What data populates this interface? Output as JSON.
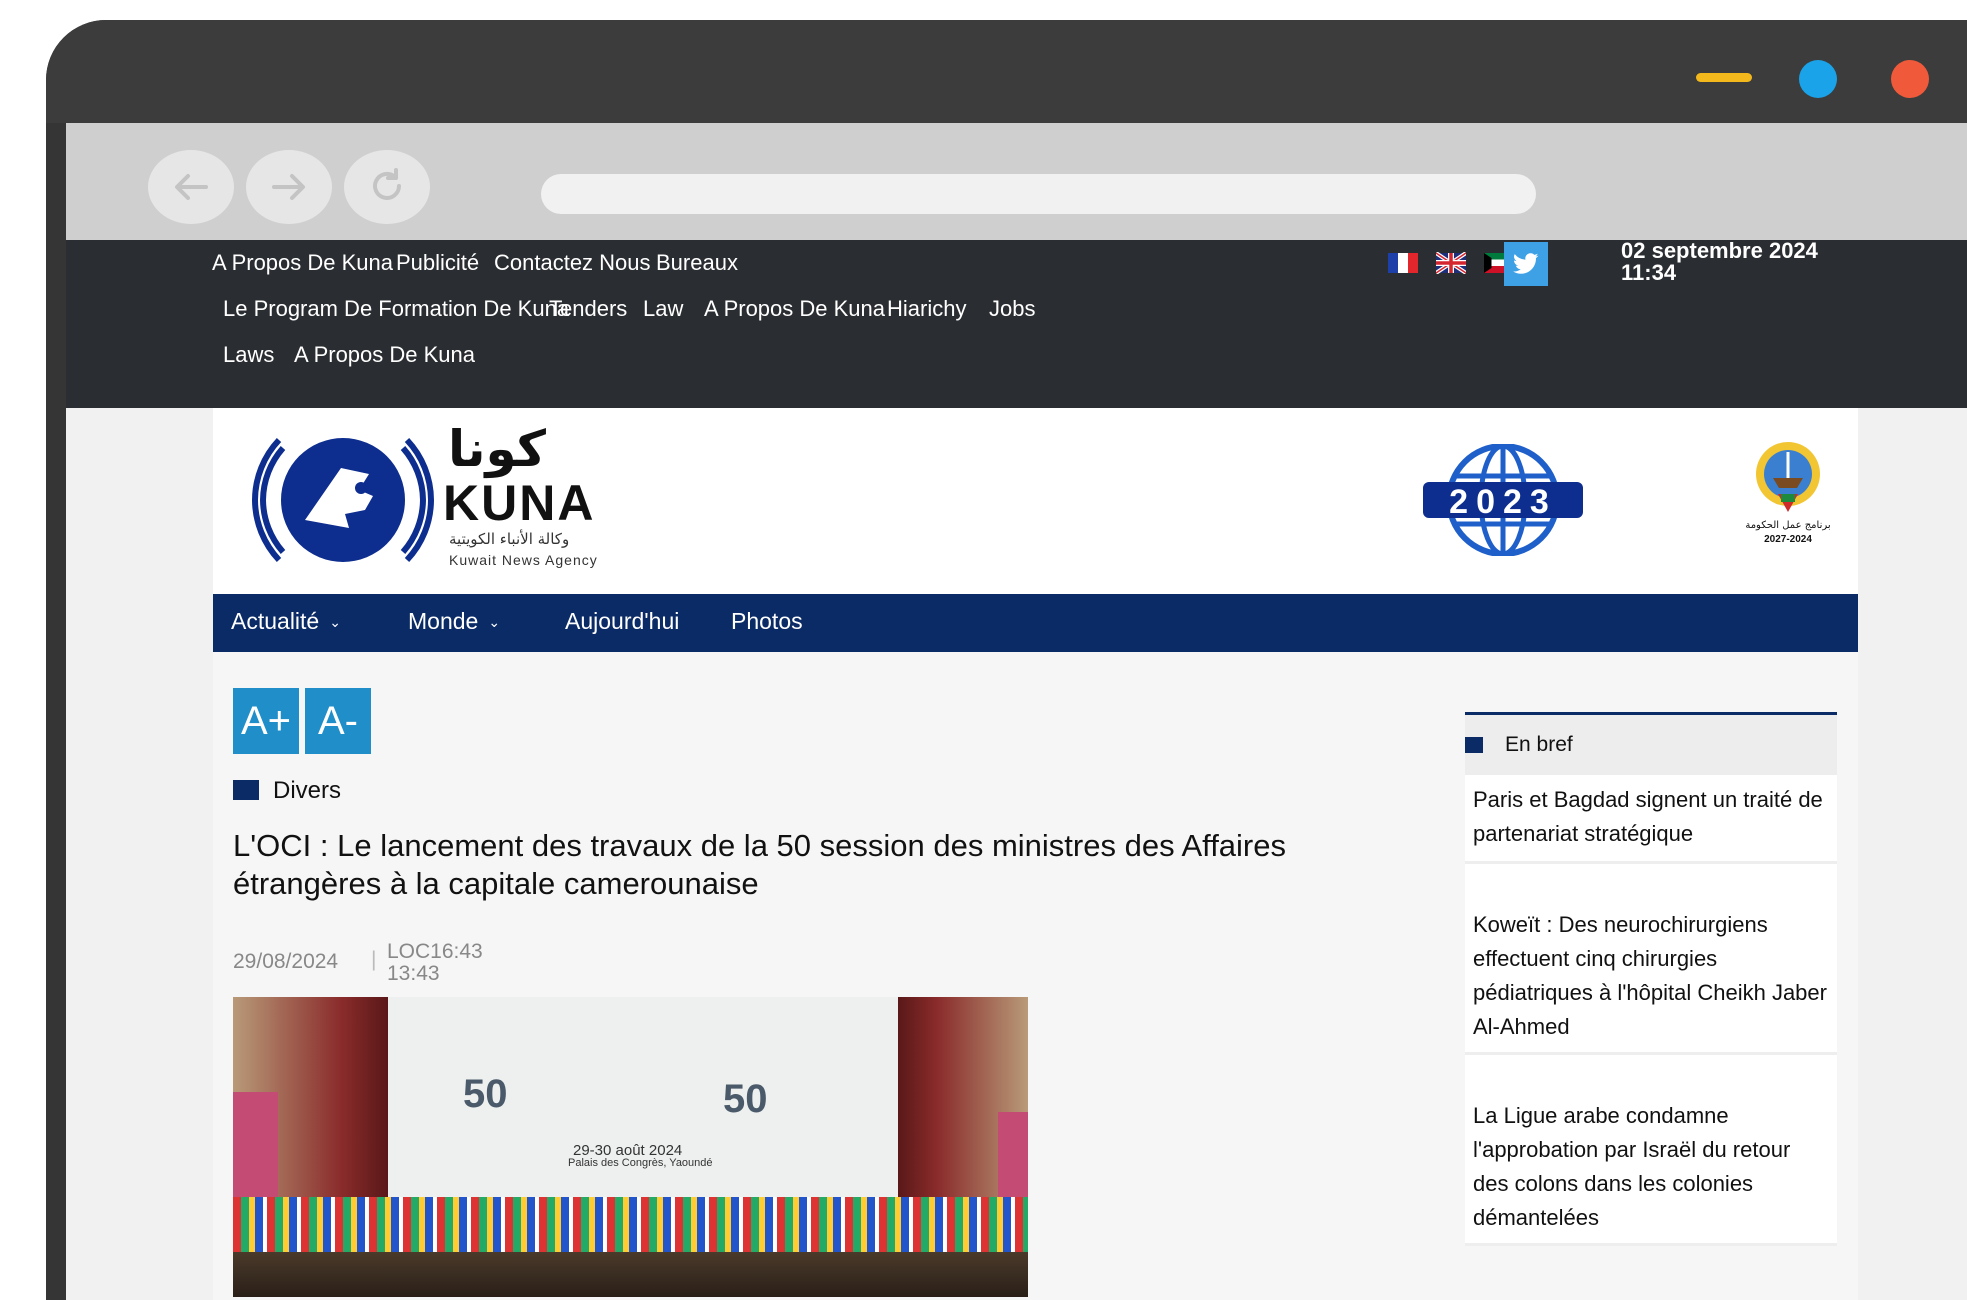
{
  "window": {
    "controls": {
      "minimize_color": "#f2b81c",
      "maximize_color": "#1aa3e8",
      "close_color": "#f05a3a"
    },
    "nav_icons": [
      "back-arrow-icon",
      "forward-arrow-icon",
      "reload-icon"
    ]
  },
  "topbar": {
    "row1": [
      "A Propos De Kuna",
      "Publicité",
      "Contactez Nous",
      "Bureaux"
    ],
    "row2": [
      "Le Program De Formation De Kuna",
      "Tenders",
      "Law",
      "A Propos De Kuna",
      "Hiarichy",
      "Jobs"
    ],
    "row3": [
      "Laws",
      "A Propos De Kuna"
    ],
    "flags": [
      "france-flag-icon",
      "uk-flag-icon",
      "kuwait-flag-icon"
    ],
    "twitter_icon": "twitter-icon",
    "date": "02 septembre 2024",
    "time": "11:34"
  },
  "header": {
    "logo_arabic": "كونا",
    "logo_latin": "KUNA",
    "logo_sub_arabic": "وكالة الأنباء الكويتية",
    "logo_sub_latin": "Kuwait News Agency",
    "badge_year": "2023",
    "emblem_text_arabic": "برنامج عمل الحكومة",
    "emblem_years": "2027-2024"
  },
  "mainnav": {
    "items": [
      {
        "label": "Actualité",
        "has_dropdown": true
      },
      {
        "label": "Monde",
        "has_dropdown": true
      },
      {
        "label": "Aujourd'hui",
        "has_dropdown": false
      },
      {
        "label": "Photos",
        "has_dropdown": false
      }
    ]
  },
  "article": {
    "font_increase": "A+",
    "font_decrease": "A-",
    "category": "Divers",
    "title": "L'OCI : Le lancement des travaux de la 50 session des ministres des Affaires étrangères à la capitale camerounaise",
    "date": "29/08/2024",
    "loc_time": "LOC16:43",
    "gmt_time": "13:43",
    "photo": {
      "big_number": "50",
      "banner_date": "29-30 août 2024",
      "banner_place": "Palais des Congrès, Yaoundé"
    }
  },
  "sidebar": {
    "title": "En bref",
    "items": [
      "Paris et Bagdad signent un traité de partenariat stratégique",
      "Koweït : Des neurochirurgiens effectuent cinq chirurgies pédiatriques à l'hôpital Cheikh Jaber Al-Ahmed",
      "La Ligue arabe condamne l'approbation par Israël du retour des colons dans les colonies démantelées"
    ]
  },
  "colors": {
    "topbar_bg": "#2a2d31",
    "nav_bg": "#0b2b66",
    "accent_blue": "#1f8ec9",
    "twitter_blue": "#3ea1e6"
  }
}
